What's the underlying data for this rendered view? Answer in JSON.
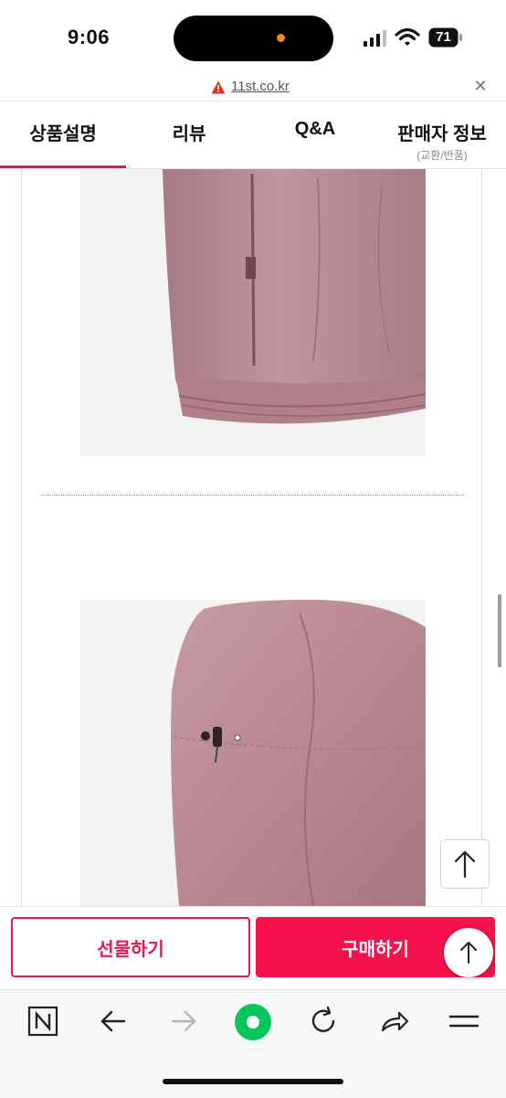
{
  "status": {
    "time": "9:06",
    "battery": "71"
  },
  "url": {
    "domain": "11st.co.kr",
    "close": "✕"
  },
  "tabs": [
    {
      "label": "상품설명",
      "sub": ""
    },
    {
      "label": "리뷰",
      "sub": ""
    },
    {
      "label": "Q&A",
      "sub": ""
    },
    {
      "label": "판매자 정보",
      "sub": "(교환/반품)"
    }
  ],
  "active_tab": "상품설명",
  "images": [
    {
      "name": "jacket-hem-pocket-photo"
    },
    {
      "name": "jacket-hood-drawcord-photo"
    }
  ],
  "purchase": {
    "gift_label": "선물하기",
    "buy_label": "구매하기"
  },
  "colors": {
    "accent": "#e8174d",
    "buy": "#f5114b",
    "jacket": "#b98892",
    "naver_green": "#03c75a"
  },
  "toolbar": {
    "icons": [
      "naver-home-icon",
      "back-arrow-icon",
      "forward-arrow-icon",
      "naver-green-dot-icon",
      "reload-icon",
      "share-icon",
      "menu-icon"
    ]
  }
}
